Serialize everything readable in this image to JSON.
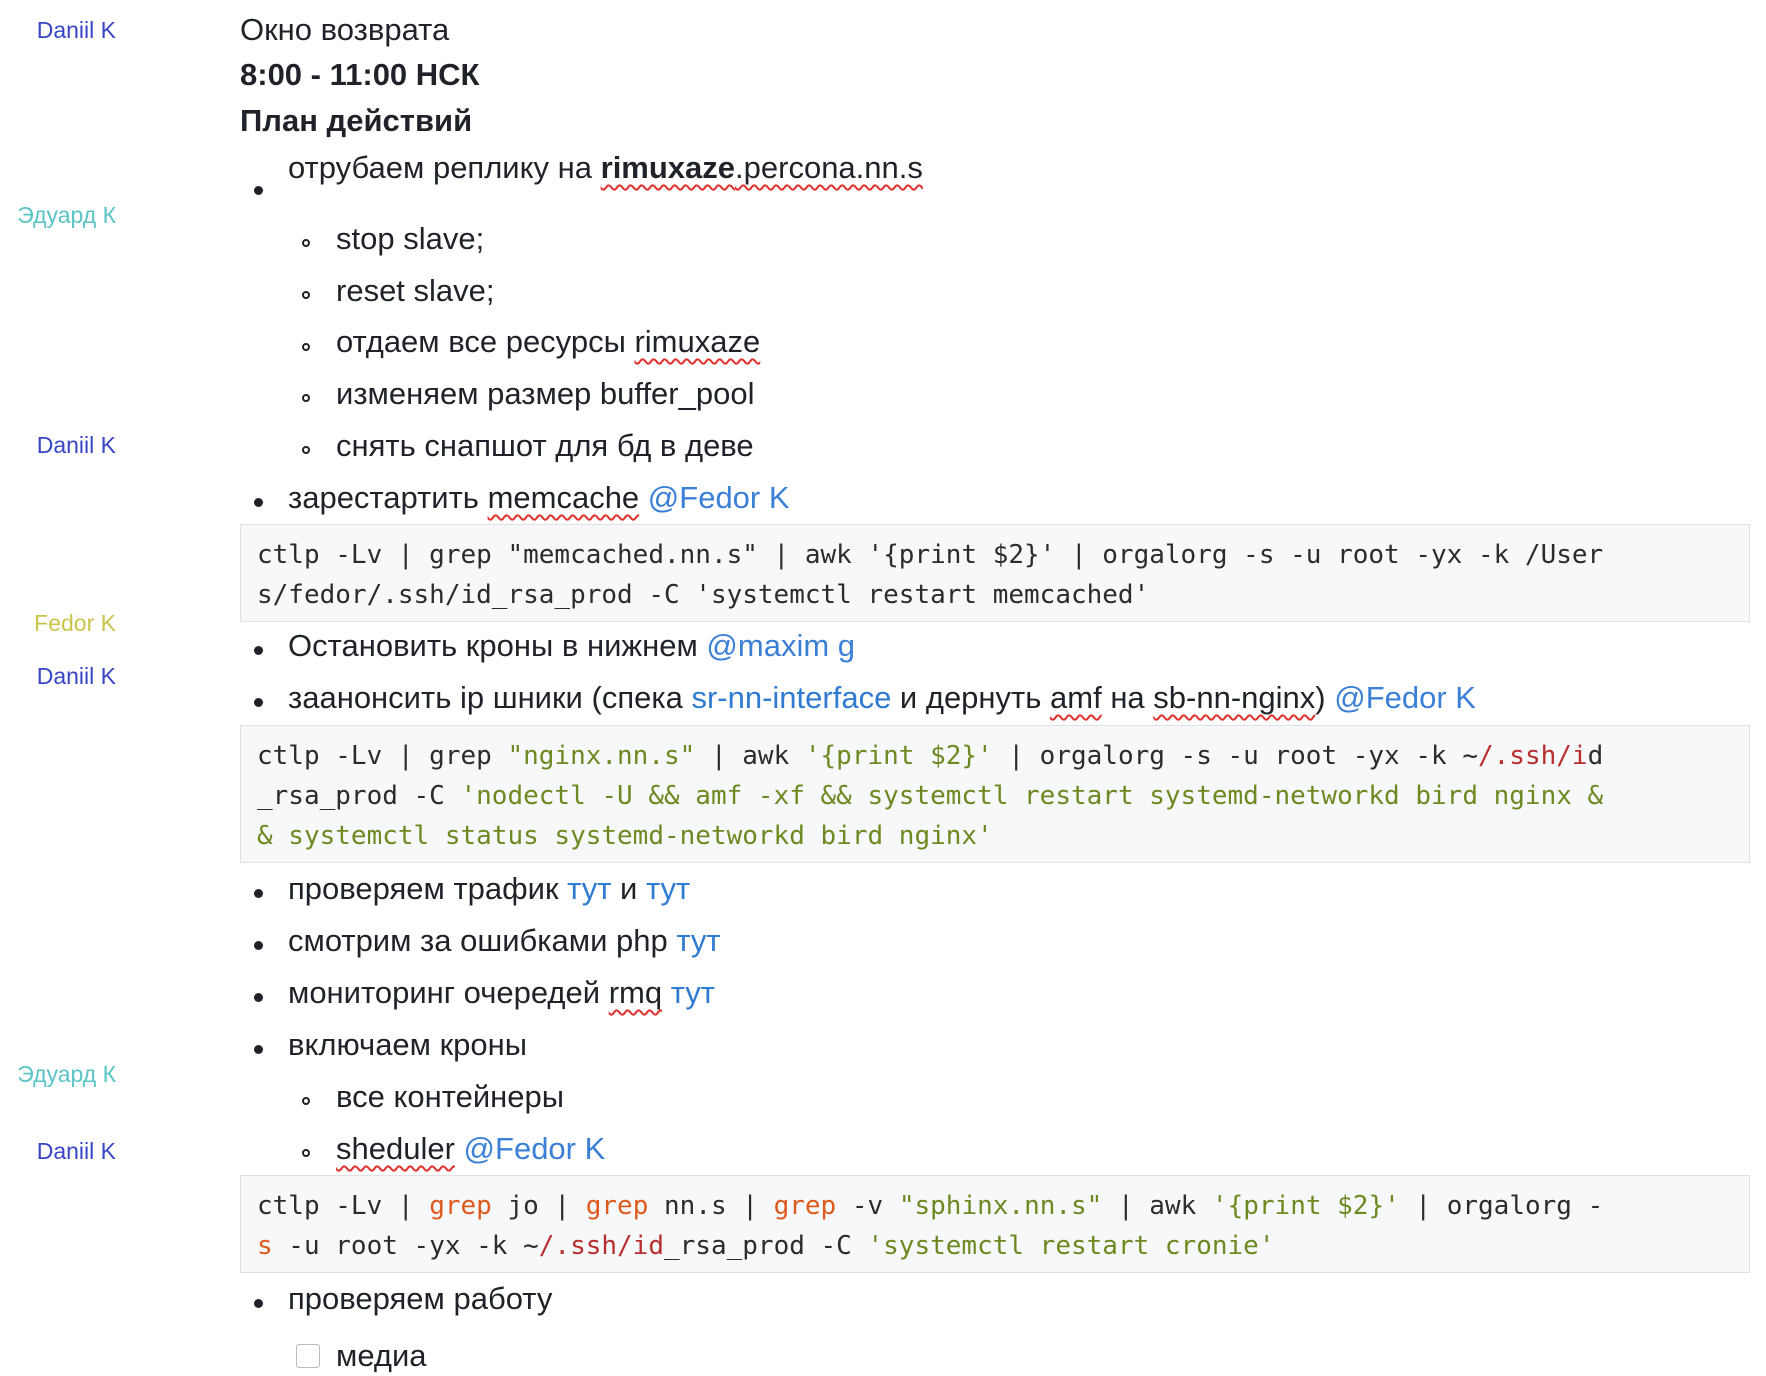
{
  "authors": {
    "a1": "Daniil K",
    "a2": "Эдуард К",
    "a3": "Daniil K",
    "a4": "Fedor K",
    "a5": "Daniil K",
    "a6": "Эдуард К",
    "a7": "Daniil K"
  },
  "doc": {
    "window_label": "Окно возврата",
    "time_window": "8:00 - 11:00 НСК",
    "plan_heading": "План действий",
    "i1_prefix": "отрубаем реплику на ",
    "i1_host_bold": "rimuxaze",
    "i1_host_rest": ".percona.nn.s",
    "i1_sub1": "stop slave;",
    "i1_sub2": "reset slave;",
    "i1_sub3_prefix": "отдаем все ресурсы ",
    "i1_sub3_word": "rimuxaze",
    "i1_sub4": "изменяем размер buffer_pool",
    "i1_sub5": "снять снапшот для бд в деве",
    "i2_prefix": "зарестартить ",
    "i2_word": "memcache",
    "i2_mention": "@Fedor K",
    "code1_l1": "ctlp -Lv | grep \"memcached.nn.s\" | awk '{print $2}' | orgalorg -s -u root -yx -k /User",
    "code1_l2": "s/fedor/.ssh/id_rsa_prod -C 'systemctl restart memcached'",
    "i3_text": "Остановить кроны в нижнем ",
    "i3_mention": "@maxim g",
    "i4_prefix": "заанонсить ip шники (спека ",
    "i4_link": "sr-nn-interface",
    "i4_mid": " и дернуть ",
    "i4_word": "amf",
    "i4_mid2": " на ",
    "i4_host": "sb-nn-nginx",
    "i4_close": ") ",
    "i4_mention": "@Fedor K",
    "code2_a": "ctlp -Lv | grep ",
    "code2_b": "\"nginx.nn.s\"",
    "code2_c": " | awk ",
    "code2_d": "'{print $2}'",
    "code2_e": " | orgalorg -s -u root -yx -k ~",
    "code2_f": "/.ssh/i",
    "code2_g": "d",
    "code2_h": "_rsa_prod -C ",
    "code2_i": "'nodectl -U && amf -xf && systemctl restart systemd-networkd bird nginx &",
    "code2_j": "& systemctl status systemd-networkd bird nginx'",
    "i5_prefix": "проверяем трафик ",
    "i5_link1": "тут",
    "i5_mid": " и ",
    "i5_link2": "тут",
    "i6_prefix": "смотрим за ошибками php ",
    "i6_link": "тут",
    "i7_prefix": "мониторинг очередей ",
    "i7_word": "rmq",
    "i7_link": "тут",
    "i8_text": "включаем кроны",
    "i8_sub1": "все контейнеры",
    "i8_sub2_word": "sheduler",
    "i8_sub2_mention": "@Fedor K",
    "code3_a": "ctlp -Lv | ",
    "code3_b": "grep",
    "code3_c": " jo | ",
    "code3_d": "grep",
    "code3_e": " nn.s | ",
    "code3_f": "grep",
    "code3_g": " -v ",
    "code3_h": "\"sphinx.nn.s\"",
    "code3_i": " | awk ",
    "code3_j": "'{print $2}'",
    "code3_k": " | orgalorg -",
    "code3_l": "s",
    "code3_m": " -u root -yx -k ~",
    "code3_n": "/.ssh/id",
    "code3_o": "_rsa_prod -C ",
    "code3_p": "'systemctl restart cronie'",
    "i9_text": "проверяем работу",
    "check1_label": "медиа"
  }
}
